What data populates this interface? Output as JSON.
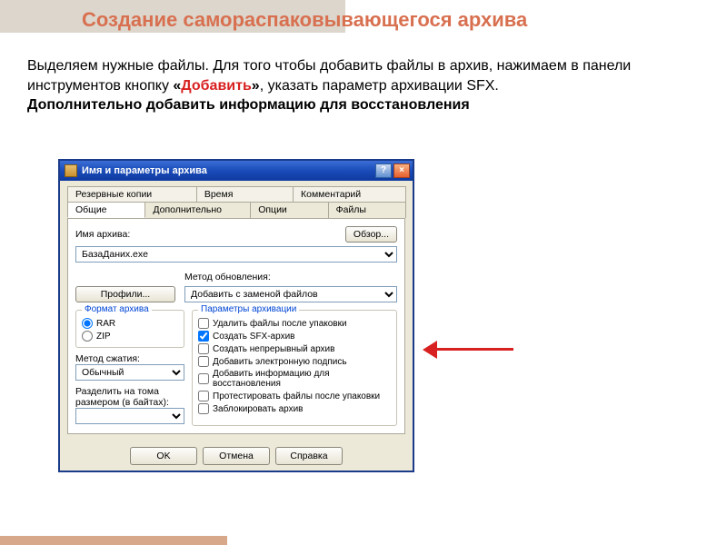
{
  "slide": {
    "title": "Создание самораспаковывающегося архива",
    "desc_pre": "Выделяем нужные файлы. Для того чтобы добавить файлы в архив, нажимаем в панели инструментов кнопку ",
    "desc_q1": "«",
    "desc_red": "Добавить",
    "desc_q2": "»",
    "desc_mid": ",  указать параметр архивации SFX.",
    "desc_bold": "Дополнительно добавить информацию для восстановления"
  },
  "dialog": {
    "title": "Имя и параметры архива",
    "tabs_top": [
      "Резервные копии",
      "Время",
      "Комментарий"
    ],
    "tabs_bottom": [
      "Общие",
      "Дополнительно",
      "Опции",
      "Файлы"
    ],
    "archive_label": "Имя архива:",
    "browse": "Обзор...",
    "archive_value": "БазаДаних.exe",
    "profiles": "Профили...",
    "update_label": "Метод обновления:",
    "update_value": "Добавить с заменой файлов",
    "format_group": "Формат архива",
    "format_rar": "RAR",
    "format_zip": "ZIP",
    "compress_label": "Метод сжатия:",
    "compress_value": "Обычный",
    "volume_label1": "Разделить на тома",
    "volume_label2": "размером (в байтах):",
    "params_group": "Параметры архивации",
    "options": [
      {
        "label": "Удалить файлы после упаковки",
        "checked": false
      },
      {
        "label": "Создать SFX-архив",
        "checked": true
      },
      {
        "label": "Создать непрерывный архив",
        "checked": false
      },
      {
        "label": "Добавить электронную подпись",
        "checked": false
      },
      {
        "label": "Добавить информацию для восстановления",
        "checked": false
      },
      {
        "label": "Протестировать файлы после упаковки",
        "checked": false
      },
      {
        "label": "Заблокировать архив",
        "checked": false
      }
    ],
    "ok": "OK",
    "cancel": "Отмена",
    "help": "Справка"
  }
}
